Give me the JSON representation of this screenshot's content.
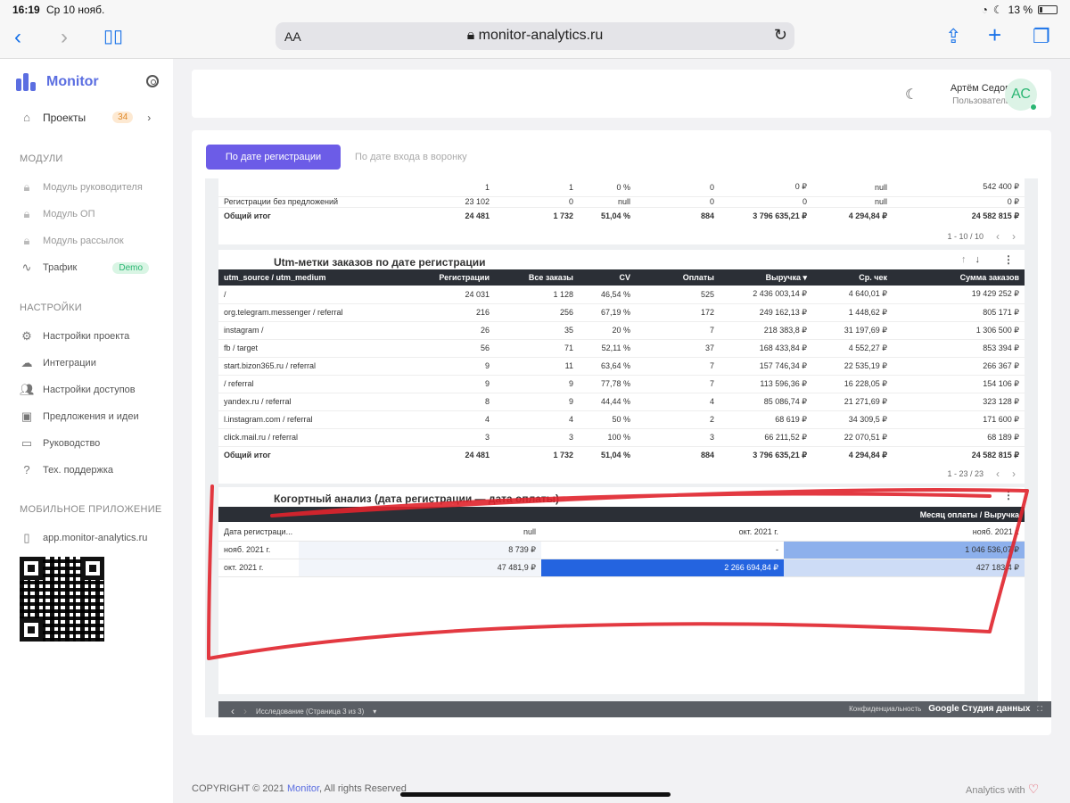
{
  "statusbar": {
    "time": "16:19",
    "date": "Ср 10 нояб.",
    "battery": "13 %"
  },
  "browser": {
    "url": "monitor-analytics.ru",
    "aa_label": "AA"
  },
  "sidebar": {
    "brand": "Monitor",
    "projects": {
      "label": "Проекты",
      "count": "34"
    },
    "modules_title": "МОДУЛИ",
    "modules": [
      {
        "label": "Модуль руководителя",
        "icon": "lock-icon"
      },
      {
        "label": "Модуль ОП",
        "icon": "lock-icon"
      },
      {
        "label": "Модуль рассылок",
        "icon": "lock-icon"
      },
      {
        "label": "Трафик",
        "icon": "pulse-icon",
        "badge": "Demo"
      }
    ],
    "settings_title": "НАСТРОЙКИ",
    "settings": [
      {
        "label": "Настройки проекта",
        "icon": "gear-icon"
      },
      {
        "label": "Интеграции",
        "icon": "cloud-icon"
      },
      {
        "label": "Настройки доступов",
        "icon": "users-icon"
      },
      {
        "label": "Предложения и идеи",
        "icon": "board-icon"
      },
      {
        "label": "Руководство",
        "icon": "monitor-icon"
      },
      {
        "label": "Тех. поддержка",
        "icon": "help-icon"
      }
    ],
    "mobile_title": "МОБИЛЬНОЕ ПРИЛОЖЕНИЕ",
    "mobile_link": "app.monitor-analytics.ru"
  },
  "header": {
    "user_name": "Артём Седов",
    "user_role": "Пользователь",
    "avatar_initials": "АС"
  },
  "tabs": {
    "active": "По дате регистрации",
    "inactive": "По дате входа в воронку"
  },
  "top_table": {
    "rows": [
      [
        "",
        "1",
        "1",
        "0 %",
        "0",
        "0 ₽",
        "null",
        "542 400 ₽"
      ],
      [
        "Регистрации без предложений",
        "23 102",
        "0",
        "null",
        "0",
        "0",
        "null",
        "0 ₽"
      ]
    ],
    "total": [
      "Общий итог",
      "24 481",
      "1 732",
      "51,04 %",
      "884",
      "3 796 635,21 ₽",
      "4 294,84 ₽",
      "24 582 815 ₽"
    ],
    "pager": "1 - 10 / 10"
  },
  "utm_table": {
    "title": "Utm-метки заказов по дате регистрации",
    "headers": [
      "utm_source / utm_medium",
      "Регистрации",
      "Все заказы",
      "CV",
      "Оплаты",
      "Выручка ▾",
      "Ср. чек",
      "Сумма заказов"
    ],
    "rows": [
      [
        "/",
        "24 031",
        "1 128",
        "46,54 %",
        "525",
        "2 436 003,14 ₽",
        "4 640,01 ₽",
        "19 429 252 ₽"
      ],
      [
        "org.telegram.messenger / referral",
        "216",
        "256",
        "67,19 %",
        "172",
        "249 162,13 ₽",
        "1 448,62 ₽",
        "805 171 ₽"
      ],
      [
        "instagram /",
        "26",
        "35",
        "20 %",
        "7",
        "218 383,8 ₽",
        "31 197,69 ₽",
        "1 306 500 ₽"
      ],
      [
        "fb / target",
        "56",
        "71",
        "52,11 %",
        "37",
        "168 433,84 ₽",
        "4 552,27 ₽",
        "853 394 ₽"
      ],
      [
        "start.bizon365.ru / referral",
        "9",
        "11",
        "63,64 %",
        "7",
        "157 746,34 ₽",
        "22 535,19 ₽",
        "266 367 ₽"
      ],
      [
        "/ referral",
        "9",
        "9",
        "77,78 %",
        "7",
        "113 596,36 ₽",
        "16 228,05 ₽",
        "154 106 ₽"
      ],
      [
        "yandex.ru / referral",
        "8",
        "9",
        "44,44 %",
        "4",
        "85 086,74 ₽",
        "21 271,69 ₽",
        "323 128 ₽"
      ],
      [
        "l.instagram.com / referral",
        "4",
        "4",
        "50 %",
        "2",
        "68 619 ₽",
        "34 309,5 ₽",
        "171 600 ₽"
      ],
      [
        "click.mail.ru / referral",
        "3",
        "3",
        "100 %",
        "3",
        "66 211,52 ₽",
        "22 070,51 ₽",
        "68 189 ₽"
      ]
    ],
    "total": [
      "Общий итог",
      "24 481",
      "1 732",
      "51,04 %",
      "884",
      "3 796 635,21 ₽",
      "4 294,84 ₽",
      "24 582 815 ₽"
    ],
    "pager": "1 - 23 / 23"
  },
  "cohort": {
    "title": "Когортный анализ (дата регистрации — дата оплаты)",
    "header": "Месяц оплаты / Выручка",
    "columns": [
      "Дата регистраци...",
      "null",
      "окт. 2021 г.",
      "нояб. 2021 г."
    ],
    "rows": [
      [
        "нояб. 2021 г.",
        "8 739 ₽",
        "-",
        "1 046 536,07 ₽"
      ],
      [
        "окт. 2021 г.",
        "47 481,9 ₽",
        "2 266 694,84 ₽",
        "427 183,4 ₽"
      ]
    ]
  },
  "report_footer": {
    "page_label": "Исследование (Страница 3 из 3)",
    "privacy": "Конфиденциальность",
    "brand": "Google Студия данных"
  },
  "footer": {
    "copyright_prefix": "COPYRIGHT © 2021 ",
    "copyright_brand": "Monitor",
    "copyright_suffix": ", All rights Reserved",
    "analytics": "Analytics with"
  },
  "colors": {
    "accent": "#6c5ce7",
    "brand": "#5b6ee1",
    "annotation": "#e0242c",
    "cohort_dark": "#2464e0",
    "cohort_mid": "#8db0ec",
    "cohort_light": "#cddcf6"
  }
}
